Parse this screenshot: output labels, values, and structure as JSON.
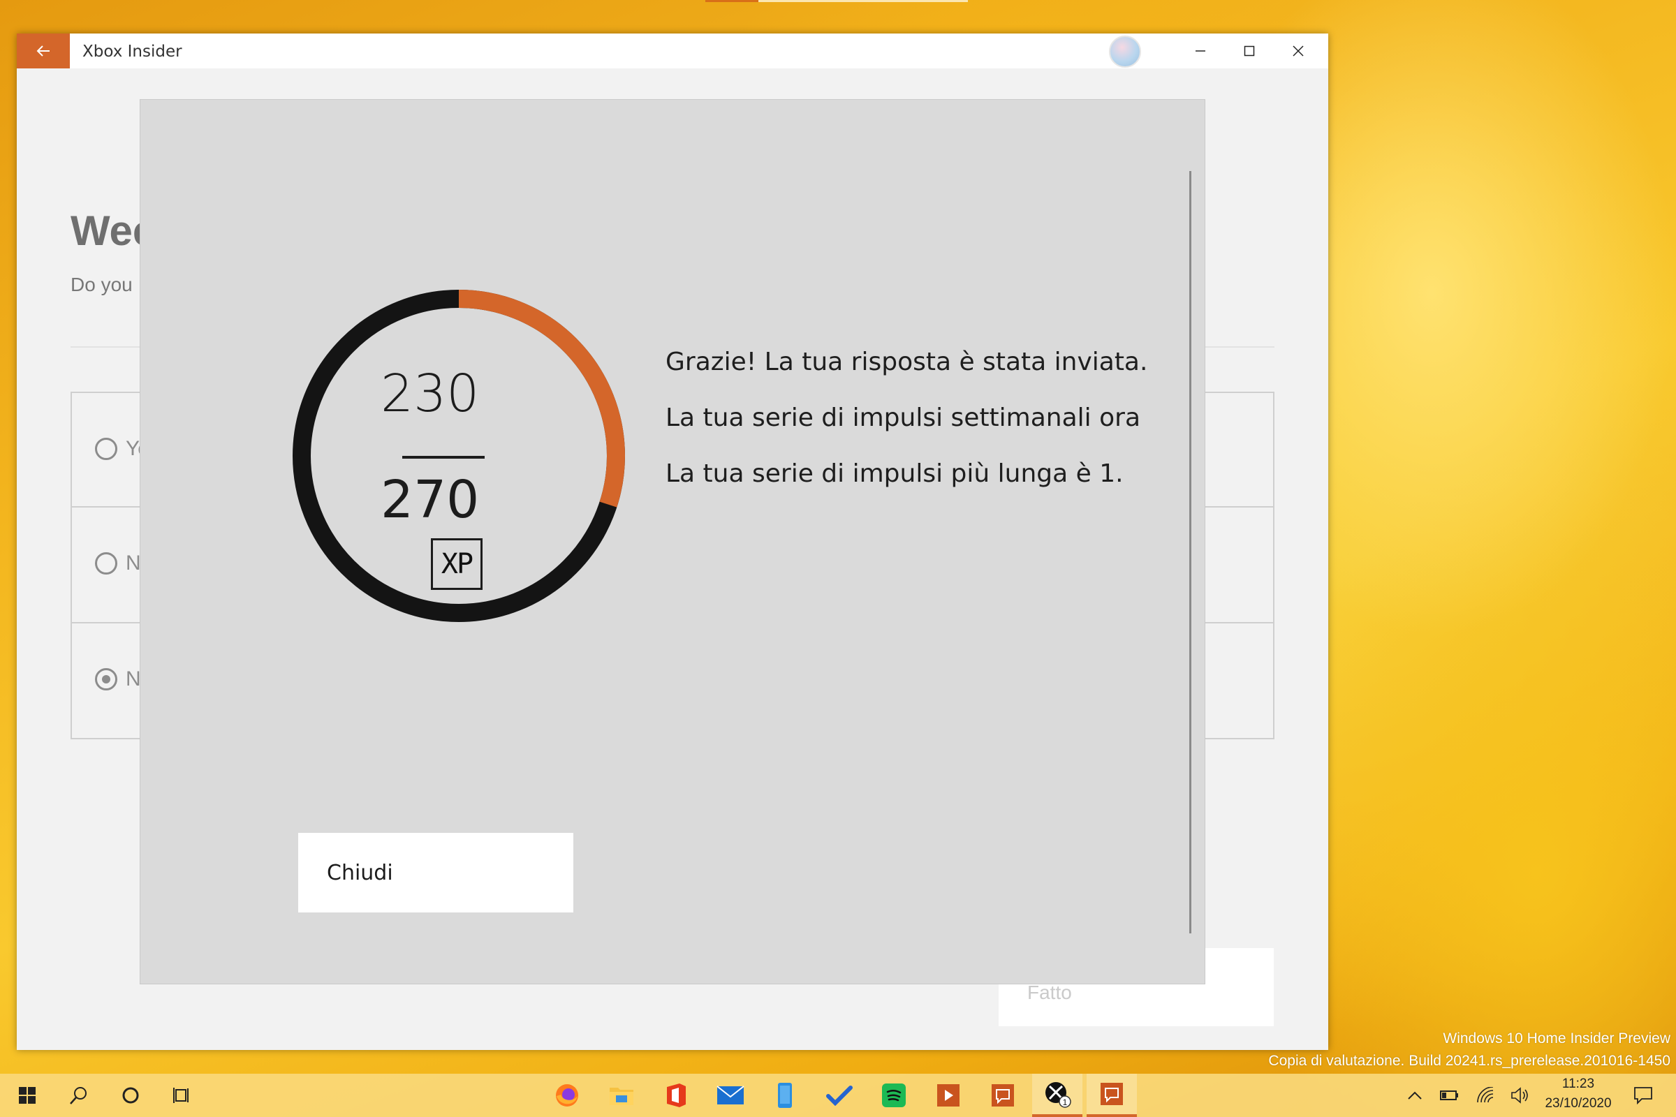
{
  "window": {
    "title": "Xbox Insider",
    "back_icon": "arrow-left-icon"
  },
  "background_page": {
    "heading": "Wee",
    "subtitle": "Do you",
    "options": [
      {
        "label": "Ye",
        "selected": false
      },
      {
        "label": "N",
        "selected": false
      },
      {
        "label": "N",
        "selected": true
      }
    ],
    "done_label": "Fatto"
  },
  "dialog": {
    "xp_current": "230",
    "xp_total": "270",
    "xp_badge": "XP",
    "progress_fraction": 0.3,
    "messages": [
      "Grazie! La tua risposta è stata inviata.",
      "La tua serie di impulsi settimanali ora",
      "La tua serie di impulsi più lunga è 1."
    ],
    "close_label": "Chiudi",
    "colors": {
      "ring_progress": "#d4662a",
      "ring_track": "#141414"
    }
  },
  "watermark": {
    "line1": "Windows 10 Home Insider Preview",
    "line2": "Copia di valutazione. Build 20241.rs_prerelease.201016-1450"
  },
  "taskbar": {
    "system_icons": [
      "start-icon",
      "search-icon",
      "cortana-icon",
      "task-view-icon"
    ],
    "apps": [
      "firefox-icon",
      "file-explorer-icon",
      "office-icon",
      "mail-icon",
      "phone-icon",
      "todo-icon",
      "spotify-icon",
      "media-player-icon",
      "feedback-icon",
      "xbox-icon",
      "feedback-hub-icon"
    ],
    "xbox_badge": "1",
    "time": "11:23",
    "date": "23/10/2020"
  }
}
